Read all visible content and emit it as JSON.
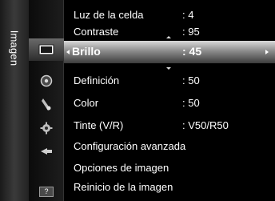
{
  "side_label": "Imagen",
  "icons": [
    {
      "name": "picture-icon"
    },
    {
      "name": "sound-icon"
    },
    {
      "name": "channel-icon"
    },
    {
      "name": "setup-icon"
    },
    {
      "name": "input-icon"
    },
    {
      "name": "help-icon",
      "glyph": "?"
    }
  ],
  "menu": {
    "rows": [
      {
        "label": "Luz de la celda",
        "value": ": 4"
      },
      {
        "label": "Contraste",
        "value": ": 95"
      },
      {
        "label": "Brillo",
        "value": ": 45"
      },
      {
        "label": "Definición",
        "value": ": 50"
      },
      {
        "label": "Color",
        "value": ": 50"
      },
      {
        "label": "Tinte (V/R)",
        "value": ": V50/R50"
      },
      {
        "label": "Configuración avanzada",
        "value": ""
      },
      {
        "label": "Opciones de imagen",
        "value": ""
      },
      {
        "label": "Reinicio de la imagen",
        "value": ""
      }
    ]
  },
  "colors": {
    "highlight": "#8c8c8c",
    "background": "#000000",
    "text": "#ffffff"
  }
}
